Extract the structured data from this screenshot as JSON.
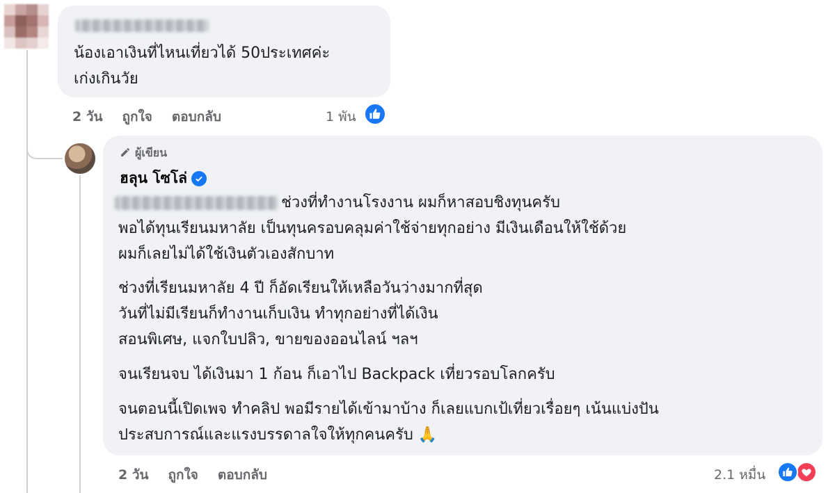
{
  "colors": {
    "bubble": "#f0f2f5",
    "meta_text": "#65676b",
    "like_blue": "#1877f2",
    "love_red": "#f33e58",
    "thread_line": "#ced0d4"
  },
  "top_comment": {
    "author_redacted": true,
    "lines": [
      "น้องเอาเงินที่ไหนเที่ยวได้ 50ประเทศค่ะ",
      "เก่งเกินวัย"
    ],
    "time": "2 วัน",
    "like_label": "ถูกใจ",
    "reply_label": "ตอบกลับ",
    "reaction_count": "1 พัน",
    "reaction_icons": [
      "like-icon"
    ]
  },
  "reply": {
    "author_badge_label": "ผู้เขียน",
    "author_name": "ฮลุน โซโล่",
    "verified_icon": "verified-badge-icon",
    "mention_redacted": true,
    "paragraphs": [
      [
        "ช่วงที่ทำงานโรงงาน ผมก็หาสอบชิงทุนครับ",
        "พอได้ทุนเรียนมหาลัย เป็นทุนครอบคลุมค่าใช้จ่ายทุกอย่าง มีเงินเดือนให้ใช้ด้วย",
        "ผมก็เลยไม่ได้ใช้เงินตัวเองสักบาท"
      ],
      [
        "ช่วงที่เรียนมหาลัย 4 ปี ก็อัดเรียนให้เหลือวันว่างมากที่สุด",
        "วันที่ไม่มีเรียนก็ทำงานเก็บเงิน ทำทุกอย่างที่ได้เงิน",
        "สอนพิเศษ, แจกใบปลิว, ขายของออนไลน์ ฯลฯ"
      ],
      [
        "จนเรียนจบ ได้เงินมา 1 ก้อน ก็เอาไป Backpack เที่ยวรอบโลกครับ"
      ],
      [
        "จนตอนนี้เปิดเพจ ทำคลิป พอมีรายได้เข้ามาบ้าง ก็เลยแบกเป้เที่ยวเรื่อยๆ เน้นแบ่งปัน",
        "ประสบการณ์และแรงบรรดาลใจให้ทุกคนครับ"
      ]
    ],
    "emoji": "🙏",
    "time": "2 วัน",
    "like_label": "ถูกใจ",
    "reply_label": "ตอบกลับ",
    "reaction_count": "2.1 หมื่น",
    "reaction_icons": [
      "like-icon",
      "love-icon"
    ]
  }
}
